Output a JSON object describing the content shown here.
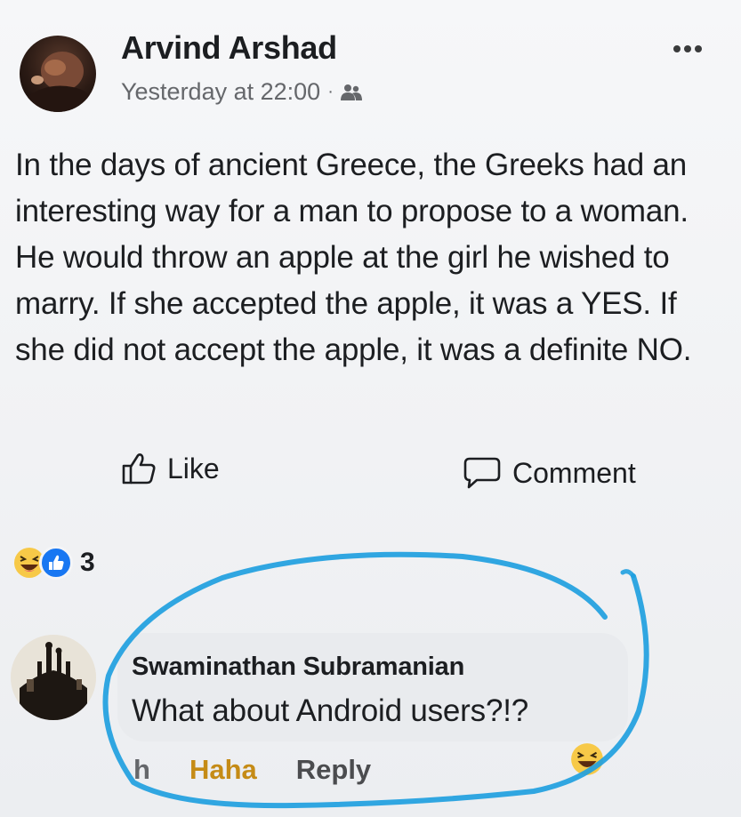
{
  "post": {
    "author": "Arvind Arshad",
    "timestamp": "Yesterday at 22:00",
    "separator": "·",
    "audience_icon": "friends-icon",
    "more_icon": "more-options-icon",
    "text": "In the days of ancient Greece, the Greeks had an interesting way for a man to propose to a woman. He would throw an apple at the girl he wished to marry. If she accepted the apple, it was a YES. If she did not accept the apple, it was a definite NO."
  },
  "actions": {
    "like_label": "Like",
    "comment_label": "Comment"
  },
  "reactions": {
    "icons": [
      "haha-reaction-icon",
      "like-reaction-icon"
    ],
    "count": "3"
  },
  "comment": {
    "author": "Swaminathan Subramanian",
    "text": "What about Android users?!?",
    "time_label": "h",
    "haha_label": "Haha",
    "reply_label": "Reply",
    "reaction_icon": "haha-reaction-icon"
  },
  "colors": {
    "like_blue": "#1877f2",
    "haha_yellow": "#f7c948",
    "haha_text": "#c58b16",
    "marker_blue": "#1fa0e0"
  }
}
